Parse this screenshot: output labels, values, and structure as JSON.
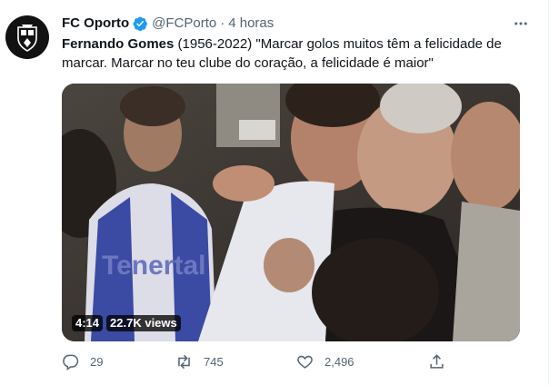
{
  "tweet": {
    "author_name": "FC Oporto",
    "handle": "@FCPorto",
    "separator": "·",
    "time": "4 horas",
    "text_bold": "Fernando Gomes",
    "text_rest": " (1956-2022) \"Marcar golos muitos têm a felicidade de marcar. Marcar no teu clube do coração, a felicidade é maior\"",
    "video": {
      "duration": "4:14",
      "views": "22.7K views"
    },
    "jersey_text": "Tenertal",
    "actions": {
      "replies": "29",
      "retweets": "745",
      "likes": "2,496"
    }
  },
  "icons": {
    "verified": "verified-badge-icon",
    "more": "more-options-icon",
    "reply": "reply-icon",
    "retweet": "retweet-icon",
    "like": "heart-icon",
    "share": "share-icon"
  },
  "colors": {
    "verified": "#1d9bf0",
    "muted": "#536471",
    "text": "#0f1419"
  }
}
